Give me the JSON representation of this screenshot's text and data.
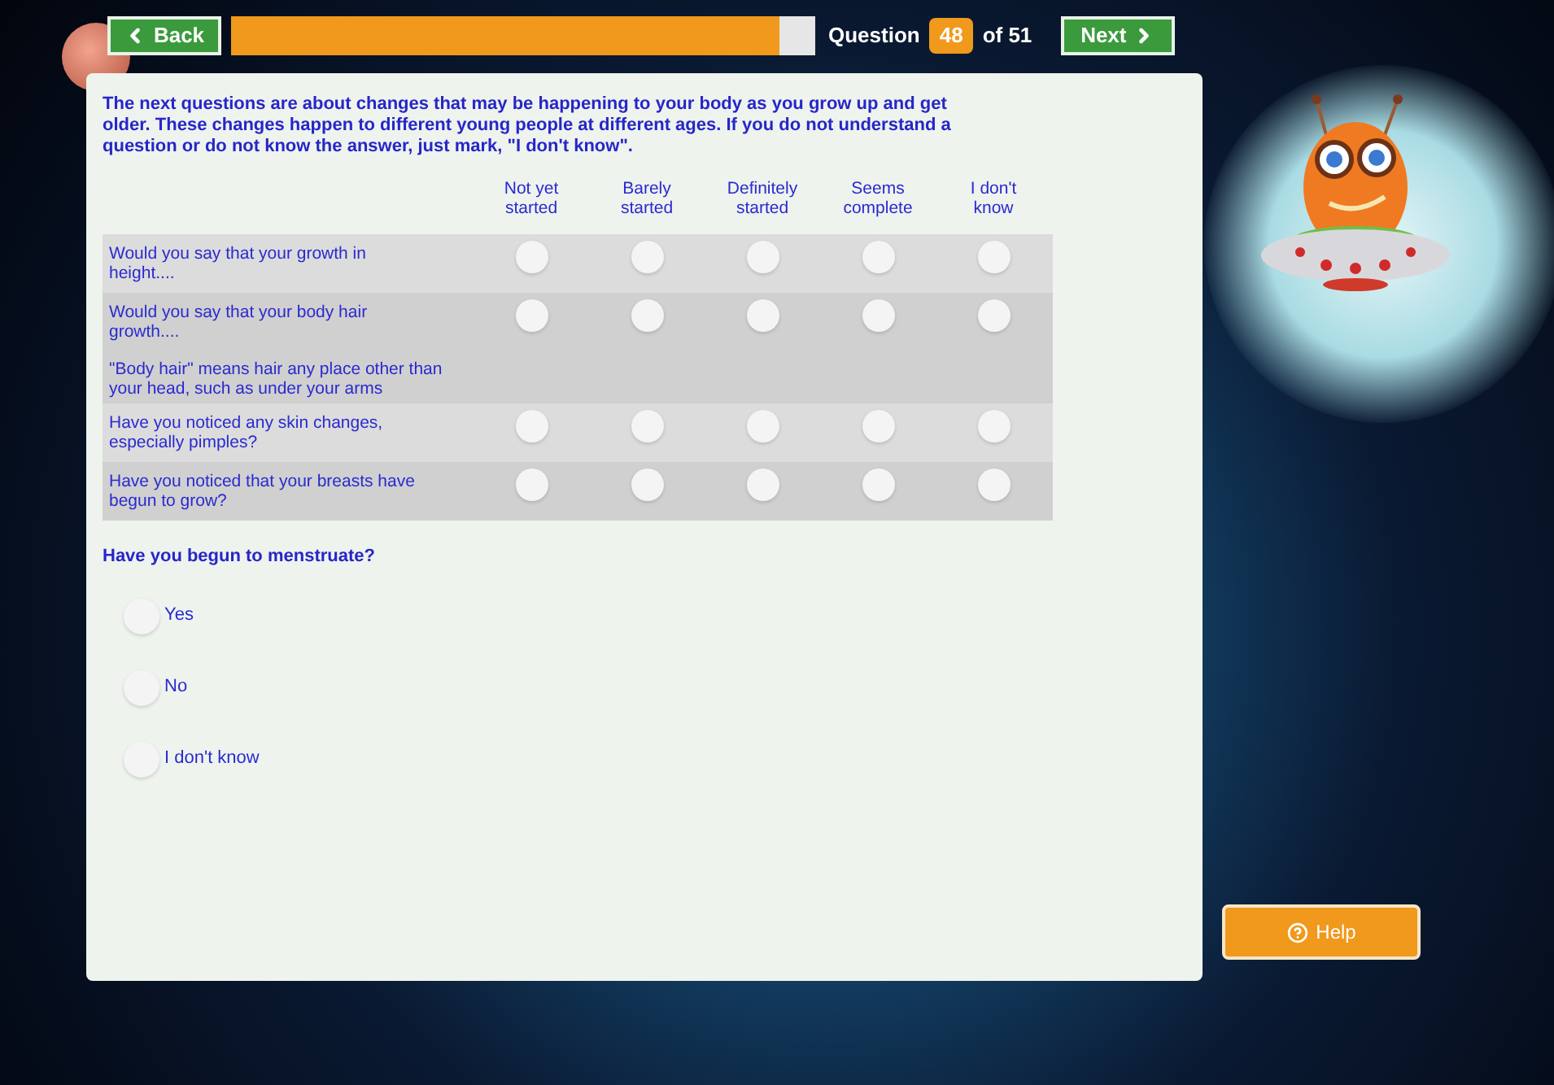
{
  "nav": {
    "back": "Back",
    "progress": {
      "level": 0.94
    },
    "question_label": "Question",
    "question_number": "48",
    "question_total": "of 51",
    "next": "Next"
  },
  "intro": "The next questions are about changes that may be happening to your body as you grow up and get older. These changes happen to different young people at different ages. If you do not understand a question or do not know the answer, just mark, \"I don't know\".",
  "grid": {
    "columns": [
      "Not yet started",
      "Barely started",
      "Definitely started",
      "Seems complete",
      "I don't know"
    ],
    "rows": [
      {
        "question": "Would you say that your growth in height....",
        "options": [
          {
            "selected": false
          },
          {
            "selected": false
          },
          {
            "selected": false
          },
          {
            "selected": false
          },
          {
            "selected": false
          }
        ]
      },
      {
        "question": "Would you say that your body hair growth....",
        "note": "\"Body hair\" means hair any place other than your head, such as under your arms",
        "options": [
          {
            "selected": false
          },
          {
            "selected": false
          },
          {
            "selected": false
          },
          {
            "selected": false
          },
          {
            "selected": false
          }
        ]
      },
      {
        "question": "Have you noticed any skin changes, especially pimples?",
        "options": [
          {
            "selected": false
          },
          {
            "selected": false
          },
          {
            "selected": false
          },
          {
            "selected": false
          },
          {
            "selected": false
          }
        ]
      },
      {
        "question": "Have you noticed that your breasts have begun to grow?",
        "options": [
          {
            "selected": false
          },
          {
            "selected": false
          },
          {
            "selected": false
          },
          {
            "selected": false
          },
          {
            "selected": false
          }
        ]
      }
    ]
  },
  "single_question": {
    "prompt": "Have you begun to menstruate?",
    "options": [
      {
        "label": "Yes",
        "selected": false
      },
      {
        "label": "No",
        "selected": false
      },
      {
        "label": "I don't know",
        "selected": false
      }
    ]
  },
  "help": "Help"
}
